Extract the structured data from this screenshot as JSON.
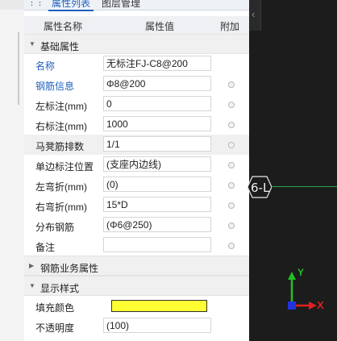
{
  "tabs": {
    "active": "属性列表",
    "inactive": "图层管理"
  },
  "header": {
    "name": "属性名称",
    "value": "属性值",
    "extra": "附加"
  },
  "sections": {
    "basic": "基础属性",
    "business": "钢筋业务属性",
    "display": "显示样式"
  },
  "rows": [
    {
      "label": "名称",
      "value": "无标注FJ-C8@200"
    },
    {
      "label": "钢筋信息",
      "value": "Φ8@200"
    },
    {
      "label": "左标注(mm)",
      "value": "0"
    },
    {
      "label": "右标注(mm)",
      "value": "1000"
    },
    {
      "label": "马凳筋排数",
      "value": "1/1"
    },
    {
      "label": "单边标注位置",
      "value": "(支座内边线)"
    },
    {
      "label": "左弯折(mm)",
      "value": "(0)"
    },
    {
      "label": "右弯折(mm)",
      "value": "15*D"
    },
    {
      "label": "分布钢筋",
      "value": "(Φ6@250)"
    },
    {
      "label": "备注",
      "value": ""
    }
  ],
  "display_rows": {
    "fill_label": "填充颜色",
    "fill_color": "#ffff33",
    "opacity_label": "不透明度",
    "opacity_value": "(100)"
  },
  "canvas": {
    "label": "6-L",
    "axis_x": "X",
    "axis_y": "Y",
    "handle_icon": "chevron-left-icon"
  },
  "colors": {
    "accent": "#1f5fbf",
    "axis_x": "#e02020",
    "axis_y": "#20c020",
    "grid_line": "#29a84d"
  }
}
